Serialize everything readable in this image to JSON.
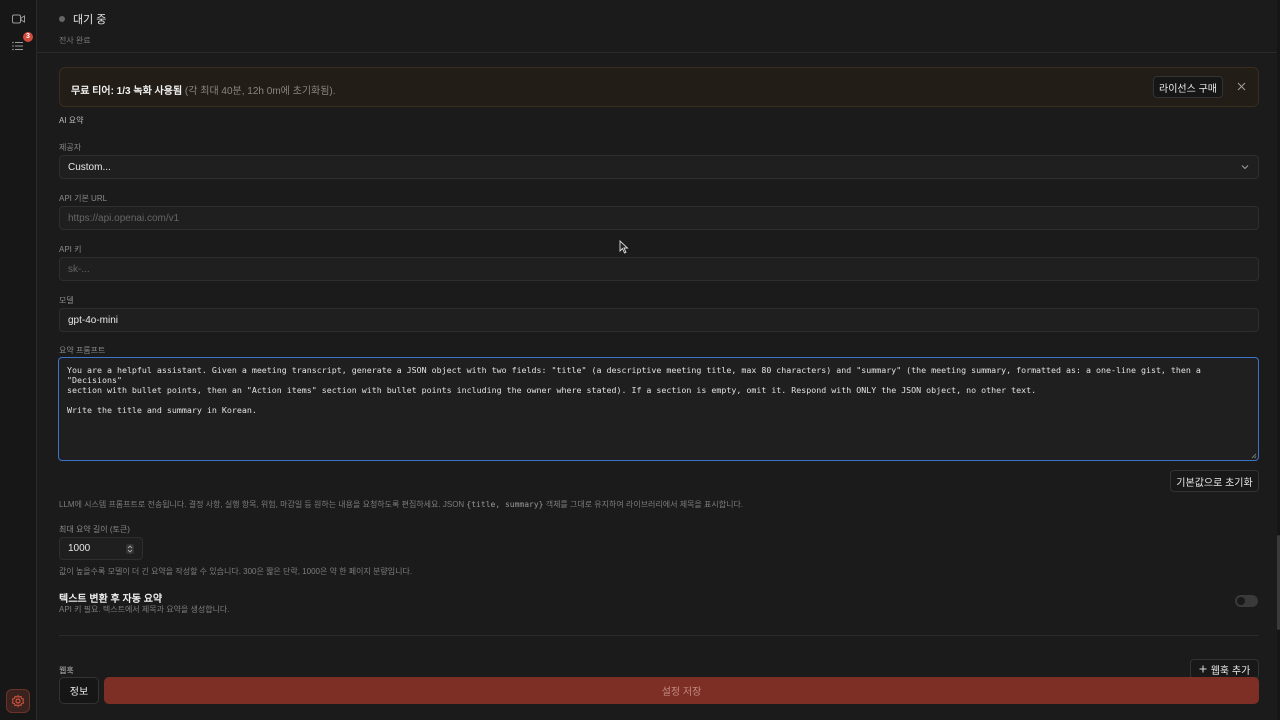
{
  "rail": {
    "notification_count": "3"
  },
  "status": {
    "label": "대기 중",
    "sub": "전사 완료"
  },
  "tier_banner": {
    "headline": "무료 티어: 1/3 녹화 사용됨",
    "note": " (각 최대 40분, 12h 0m에 초기화됨).",
    "license_button": "라이선스 구매"
  },
  "ai_summary": {
    "section_title": "AI 요약",
    "provider": {
      "label": "제공자",
      "value": "Custom..."
    },
    "api_url": {
      "label": "API 기본 URL",
      "placeholder": "https://api.openai.com/v1"
    },
    "api_key": {
      "label": "API 키",
      "placeholder": "sk-..."
    },
    "model": {
      "label": "모델",
      "value": "gpt-4o-mini"
    },
    "prompt": {
      "label": "요약 프롬프트",
      "value": "You are a helpful assistant. Given a meeting transcript, generate a JSON object with two fields: \"title\" (a descriptive meeting title, max 80 characters) and \"summary\" (the meeting summary, formatted as: a one-line gist, then a \"Decisions\"\nsection with bullet points, then an \"Action items\" section with bullet points including the owner where stated). If a section is empty, omit it. Respond with ONLY the JSON object, no other text.\n\nWrite the title and summary in Korean."
    },
    "reset_button": "기본값으로 초기화",
    "prompt_help_before": "LLM에 시스템 프롬프트로 전송됩니다. 결정 사항, 실행 항목, 위험, 마감일 등 원하는 내용을 요청하도록 편집하세요. JSON ",
    "prompt_help_code": "{title, summary}",
    "prompt_help_after": " 객체를 그대로 유지하여 라이브러리에서 제목을 표시합니다.",
    "max_length": {
      "label": "최대 요약 길이 (토큰)",
      "value": "1000",
      "help": "값이 높을수록 모델이 더 긴 요약을 작성할 수 있습니다. 300은 짧은 단락, 1000은 약 한 페이지 분량입니다."
    },
    "auto_summary": {
      "title": "텍스트 변환 후 자동 요약",
      "help": "API 키 필요. 텍스트에서 제목과 요약을 생성합니다.",
      "enabled": false
    }
  },
  "webhooks": {
    "title": "웹훅",
    "add_button": "웹훅 추가"
  },
  "footer": {
    "info_button": "정보",
    "save_button": "설정 저장"
  },
  "colors": {
    "accent_blue": "#3d73c9",
    "save_red": "#7e2f25",
    "badge_red": "#d24a3c"
  }
}
